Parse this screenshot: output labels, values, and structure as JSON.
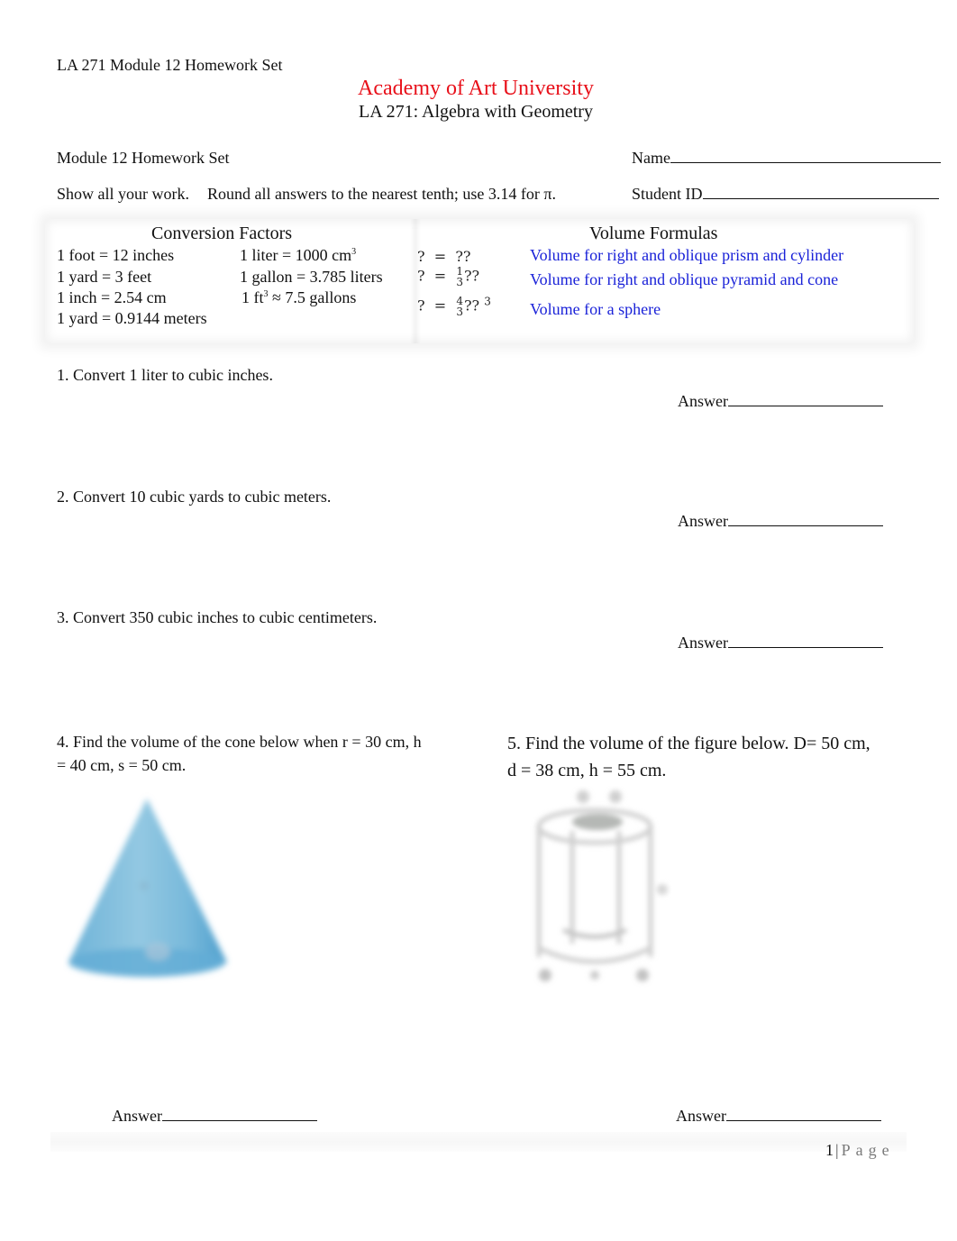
{
  "header": {
    "label": "LA 271 Module 12 Homework Set",
    "university": "Academy of Art University",
    "course": "LA 271: Algebra with Geometry",
    "university_color": "#e8101a"
  },
  "form": {
    "set_label": "Module 12 Homework Set",
    "instructions_part1": "Show all your work.",
    "instructions_part2": "Round all answers to the nearest tenth; use 3.14 for π.",
    "name_label": "Name",
    "student_id_label": "Student ID"
  },
  "conversion_factors": {
    "title": "Conversion Factors",
    "left_column": [
      "1 foot = 12 inches",
      "1 yard = 3 feet",
      "1 inch = 2.54 cm",
      "1 yard = 0.9144 meters"
    ],
    "right_column": [
      {
        "text": "1 liter = 1000 cm",
        "sup": "3",
        "after": ""
      },
      {
        "text": "1 gallon = 3.785 liters",
        "sup": "",
        "after": ""
      },
      {
        "text": "1 ft",
        "sup": "3",
        "after": " ≈ 7.5 gallons"
      }
    ]
  },
  "volume_formulas": {
    "title": "Volume Formulas",
    "desc_color": "#1a22d8",
    "items": [
      {
        "lhs": "?",
        "eq": "=",
        "num": "",
        "den": "",
        "rhs": "??",
        "exp": "",
        "description": "Volume for right and oblique prism and cylinder"
      },
      {
        "lhs": "?",
        "eq": "=",
        "num": "1",
        "den": "3",
        "rhs": "??",
        "exp": "",
        "description": "Volume for right and oblique pyramid and cone"
      },
      {
        "lhs": "?",
        "eq": "=",
        "num": "4",
        "den": "3",
        "rhs": "??",
        "exp": "3",
        "description": "Volume for a sphere"
      }
    ]
  },
  "questions": [
    {
      "text": "1. Convert 1 liter to cubic inches.",
      "answer_label": "Answer"
    },
    {
      "text": "2. Convert 10 cubic yards to cubic meters.",
      "answer_label": "Answer"
    },
    {
      "text": "3. Convert 350 cubic inches to cubic centimeters.",
      "answer_label": "Answer"
    },
    {
      "text_line1": "4. Find the volume of the cone below when r = 30 cm, h",
      "text_line2": "= 40 cm, s = 50 cm.",
      "answer_label": "Answer",
      "figure": "cone"
    },
    {
      "text_line1": "5. Find the volume of the figure below.  D= 50 cm,",
      "text_line2": "d = 38 cm, h = 55 cm.",
      "answer_label": "Answer",
      "figure": "hollow-cylinder"
    }
  ],
  "footer": {
    "page_number": "1",
    "separator": "|",
    "page_word": "Page"
  }
}
